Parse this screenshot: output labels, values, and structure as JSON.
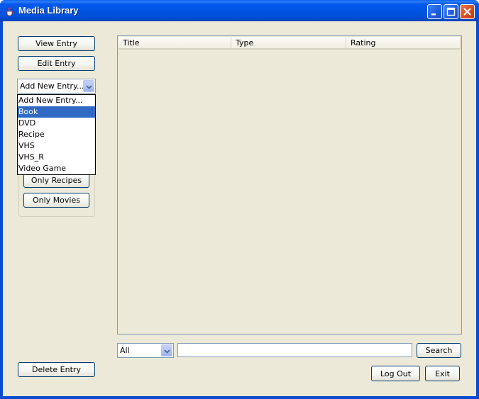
{
  "window": {
    "title": "Media Library"
  },
  "sidebar": {
    "view_entry": "View Entry",
    "edit_entry": "Edit Entry",
    "add_combo_value": "Add New Entry...",
    "add_options": [
      "Add New Entry...",
      "Book",
      "DVD",
      "Recipe",
      "VHS",
      "VHS_R",
      "Video Game"
    ],
    "add_selected_option": "Book",
    "only_recipes": "Only Recipes",
    "only_movies": "Only Movies",
    "delete_entry": "Delete Entry"
  },
  "table": {
    "columns": [
      "Title",
      "Type",
      "Rating"
    ],
    "rows": []
  },
  "search": {
    "filter_value": "All",
    "query": "",
    "button": "Search"
  },
  "footer": {
    "log_out": "Log Out",
    "exit": "Exit"
  },
  "colors": {
    "titlebar": "#0054e3",
    "window_bg": "#ece9d8",
    "selection": "#316ac5",
    "close_button": "#d44a1e"
  },
  "icons": {
    "app": "java-coffee-cup-icon",
    "minimize": "minimize-icon",
    "maximize": "maximize-icon",
    "close": "close-icon",
    "dropdown": "chevron-down-icon"
  }
}
